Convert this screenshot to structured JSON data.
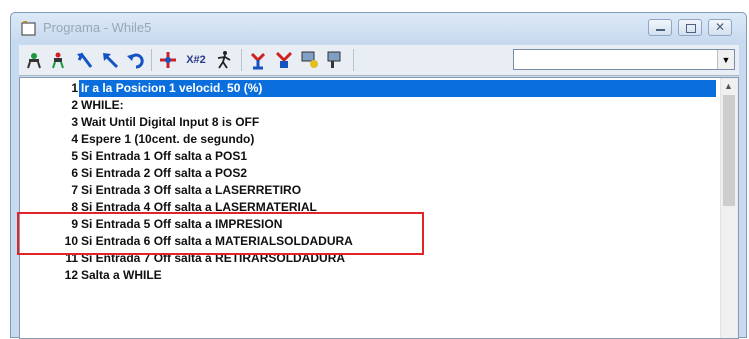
{
  "window": {
    "title": "Programa - While5",
    "buttons": [
      "minimize-icon",
      "restore-icon",
      "close-icon"
    ]
  },
  "toolbar": {
    "icons": [
      "robot-teach-icon",
      "robot-move-icon",
      "arrow-up-left-blue-icon",
      "arrow-up-left-icon",
      "undo-icon",
      "robot-axis-icon",
      "xor-icon",
      "person-walk-icon",
      "robot-io-icon",
      "robot-output-icon",
      "paint-icon",
      "camera-icon"
    ],
    "xor_label": "X#2",
    "combo_value": ""
  },
  "program": {
    "lines": [
      {
        "num": "1",
        "text": "Ir a la Posicion 1 velocid. 50 (%)",
        "selected": true
      },
      {
        "num": "2",
        "text": "WHILE:"
      },
      {
        "num": "3",
        "text": "Wait Until Digital Input 8 is OFF"
      },
      {
        "num": "4",
        "text": "Espere 1 (10cent. de segundo)"
      },
      {
        "num": "5",
        "text": "Si Entrada 1 Off salta a POS1"
      },
      {
        "num": "6",
        "text": "Si Entrada 2 Off salta a POS2"
      },
      {
        "num": "7",
        "text": "Si Entrada 3 Off salta a LASERRETIRO"
      },
      {
        "num": "8",
        "text": "Si Entrada 4 Off salta a LASERMATERIAL"
      },
      {
        "num": "9",
        "text": "Si Entrada 5 Off salta a IMPRESION"
      },
      {
        "num": "10",
        "text": "Si Entrada 6 Off salta a MATERIALSOLDADURA"
      },
      {
        "num": "11",
        "text": "Si Entrada 7 Off salta a RETIRARSOLDADURA"
      },
      {
        "num": "12",
        "text": "Salta a WHILE"
      }
    ],
    "highlighted_lines": [
      "7",
      "8"
    ]
  },
  "colors": {
    "selection": "#0a6fdc",
    "highlight_box": "#e0242a",
    "titlebar": "#c7d9ef"
  }
}
